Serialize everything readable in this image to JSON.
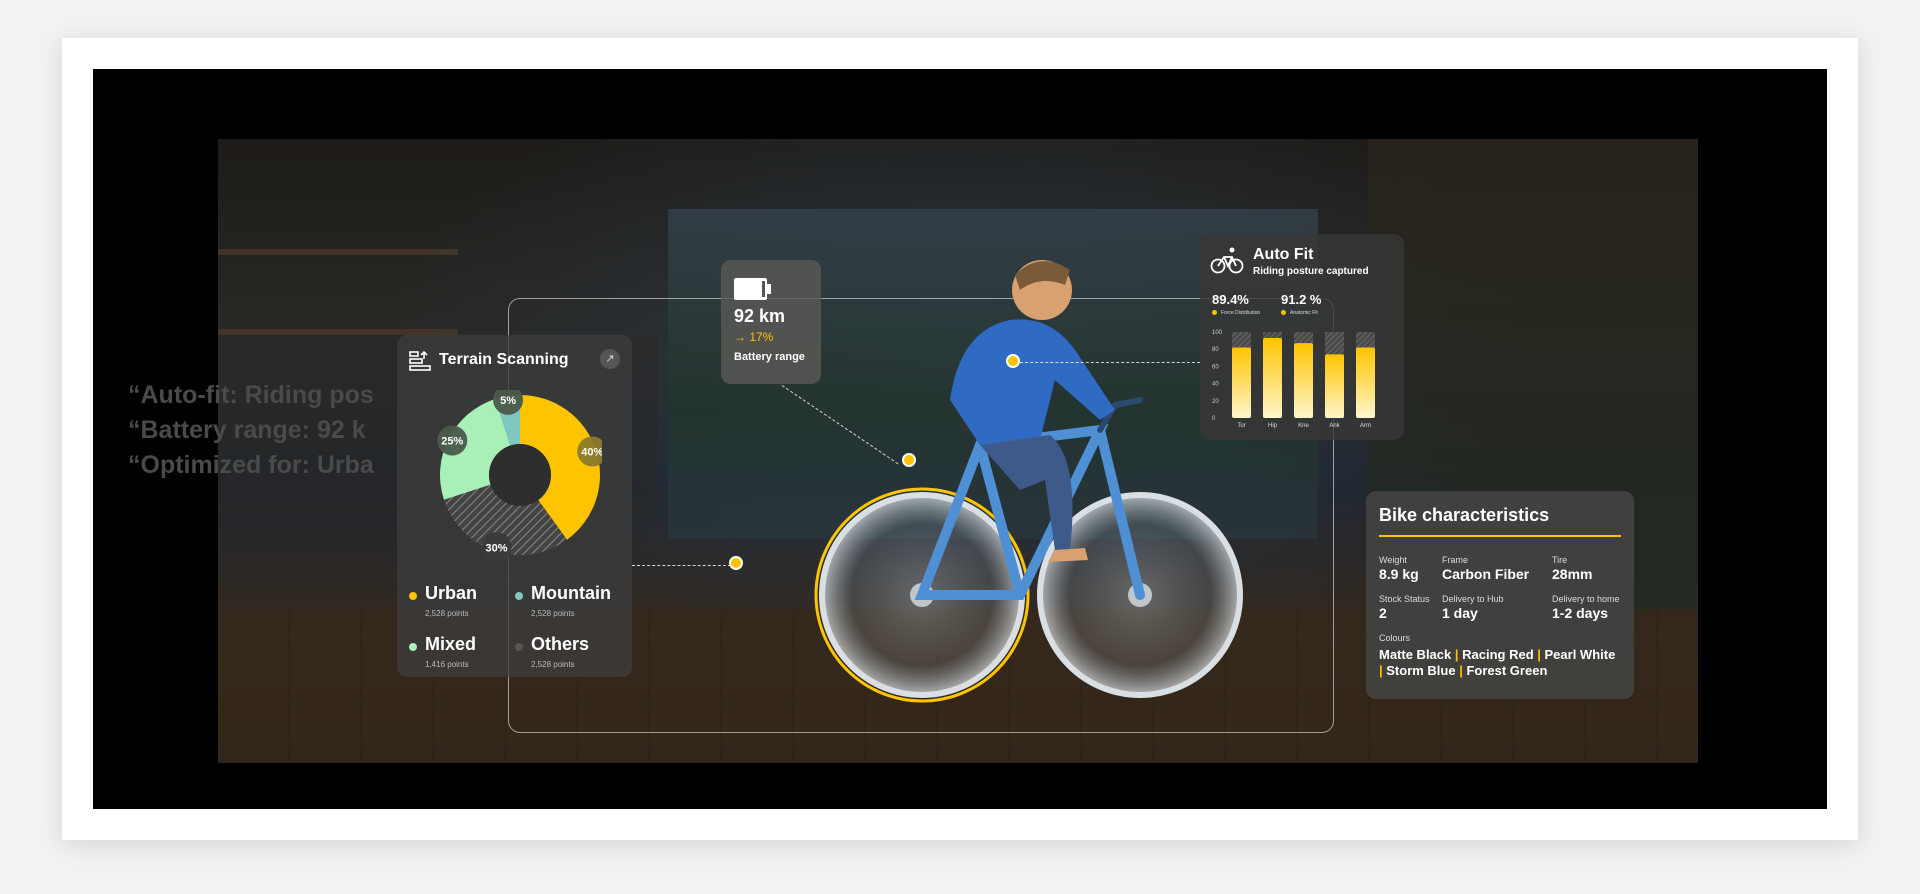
{
  "ghost_text": {
    "line1": "“Auto-fit: Riding pos",
    "line2": "“Battery range: 92 k",
    "line3": "“Optimized for: Urba"
  },
  "terrain": {
    "title": "Terrain Scanning",
    "icons": {
      "header": "terrain-scan-icon",
      "expand": "expand-arrow-icon"
    },
    "segments": [
      {
        "name": "Urban",
        "percent": 40,
        "label": "40%",
        "color": "#ffc400"
      },
      {
        "name": "Others",
        "percent": 30,
        "label": "30%",
        "color": "#555555"
      },
      {
        "name": "Mixed",
        "percent": 25,
        "label": "25%",
        "color": "#a8f0b8"
      },
      {
        "name": "Mountain",
        "percent": 5,
        "label": "5%",
        "color": "#7fc7c0"
      }
    ],
    "legend": [
      {
        "label": "Urban",
        "sub": "2,528 points",
        "color": "#ffc400"
      },
      {
        "label": "Mountain",
        "sub": "2,528 points",
        "color": "#7fc7c0"
      },
      {
        "label": "Mixed",
        "sub": "1,416 points",
        "color": "#a8f0b8"
      },
      {
        "label": "Others",
        "sub": "2,528 points",
        "color": "#555555"
      }
    ]
  },
  "battery": {
    "icon": "battery-icon",
    "value": "92 km",
    "delta": "→ 17%",
    "label": "Battery range"
  },
  "autofit": {
    "icon": "bicycle-icon",
    "title": "Auto Fit",
    "subtitle": "Riding posture captured",
    "metrics": [
      {
        "value": "89.4%",
        "label": "Force Distribution"
      },
      {
        "value": "91.2 %",
        "label": "Anatomic Fit"
      }
    ]
  },
  "chart_data": {
    "type": "bar",
    "categories": [
      "Tor",
      "Hip",
      "Kne",
      "Ank",
      "Arm"
    ],
    "values": [
      82,
      93,
      87,
      74,
      82
    ],
    "ylim": [
      0,
      100
    ],
    "yticks": [
      "100",
      "80",
      "60",
      "40",
      "20",
      "0"
    ],
    "bar_color": "#ffc400"
  },
  "bike": {
    "title": "Bike characteristics",
    "specs": [
      {
        "label": "Weight",
        "value": "8.9 kg"
      },
      {
        "label": "Frame",
        "value": "Carbon Fiber"
      },
      {
        "label": "Tire",
        "value": "28mm"
      },
      {
        "label": "Stock Status",
        "value": "2"
      },
      {
        "label": "Delivery to Hub",
        "value": "1 day"
      },
      {
        "label": "Delivery to home",
        "value": "1-2 days"
      }
    ],
    "colours_label": "Colours",
    "colours": [
      "Matte Black",
      "Racing Red",
      "Pearl White",
      "Storm Blue",
      "Forest Green"
    ]
  },
  "colors": {
    "accent": "#ffc400",
    "panel": "#3c3c3c"
  }
}
